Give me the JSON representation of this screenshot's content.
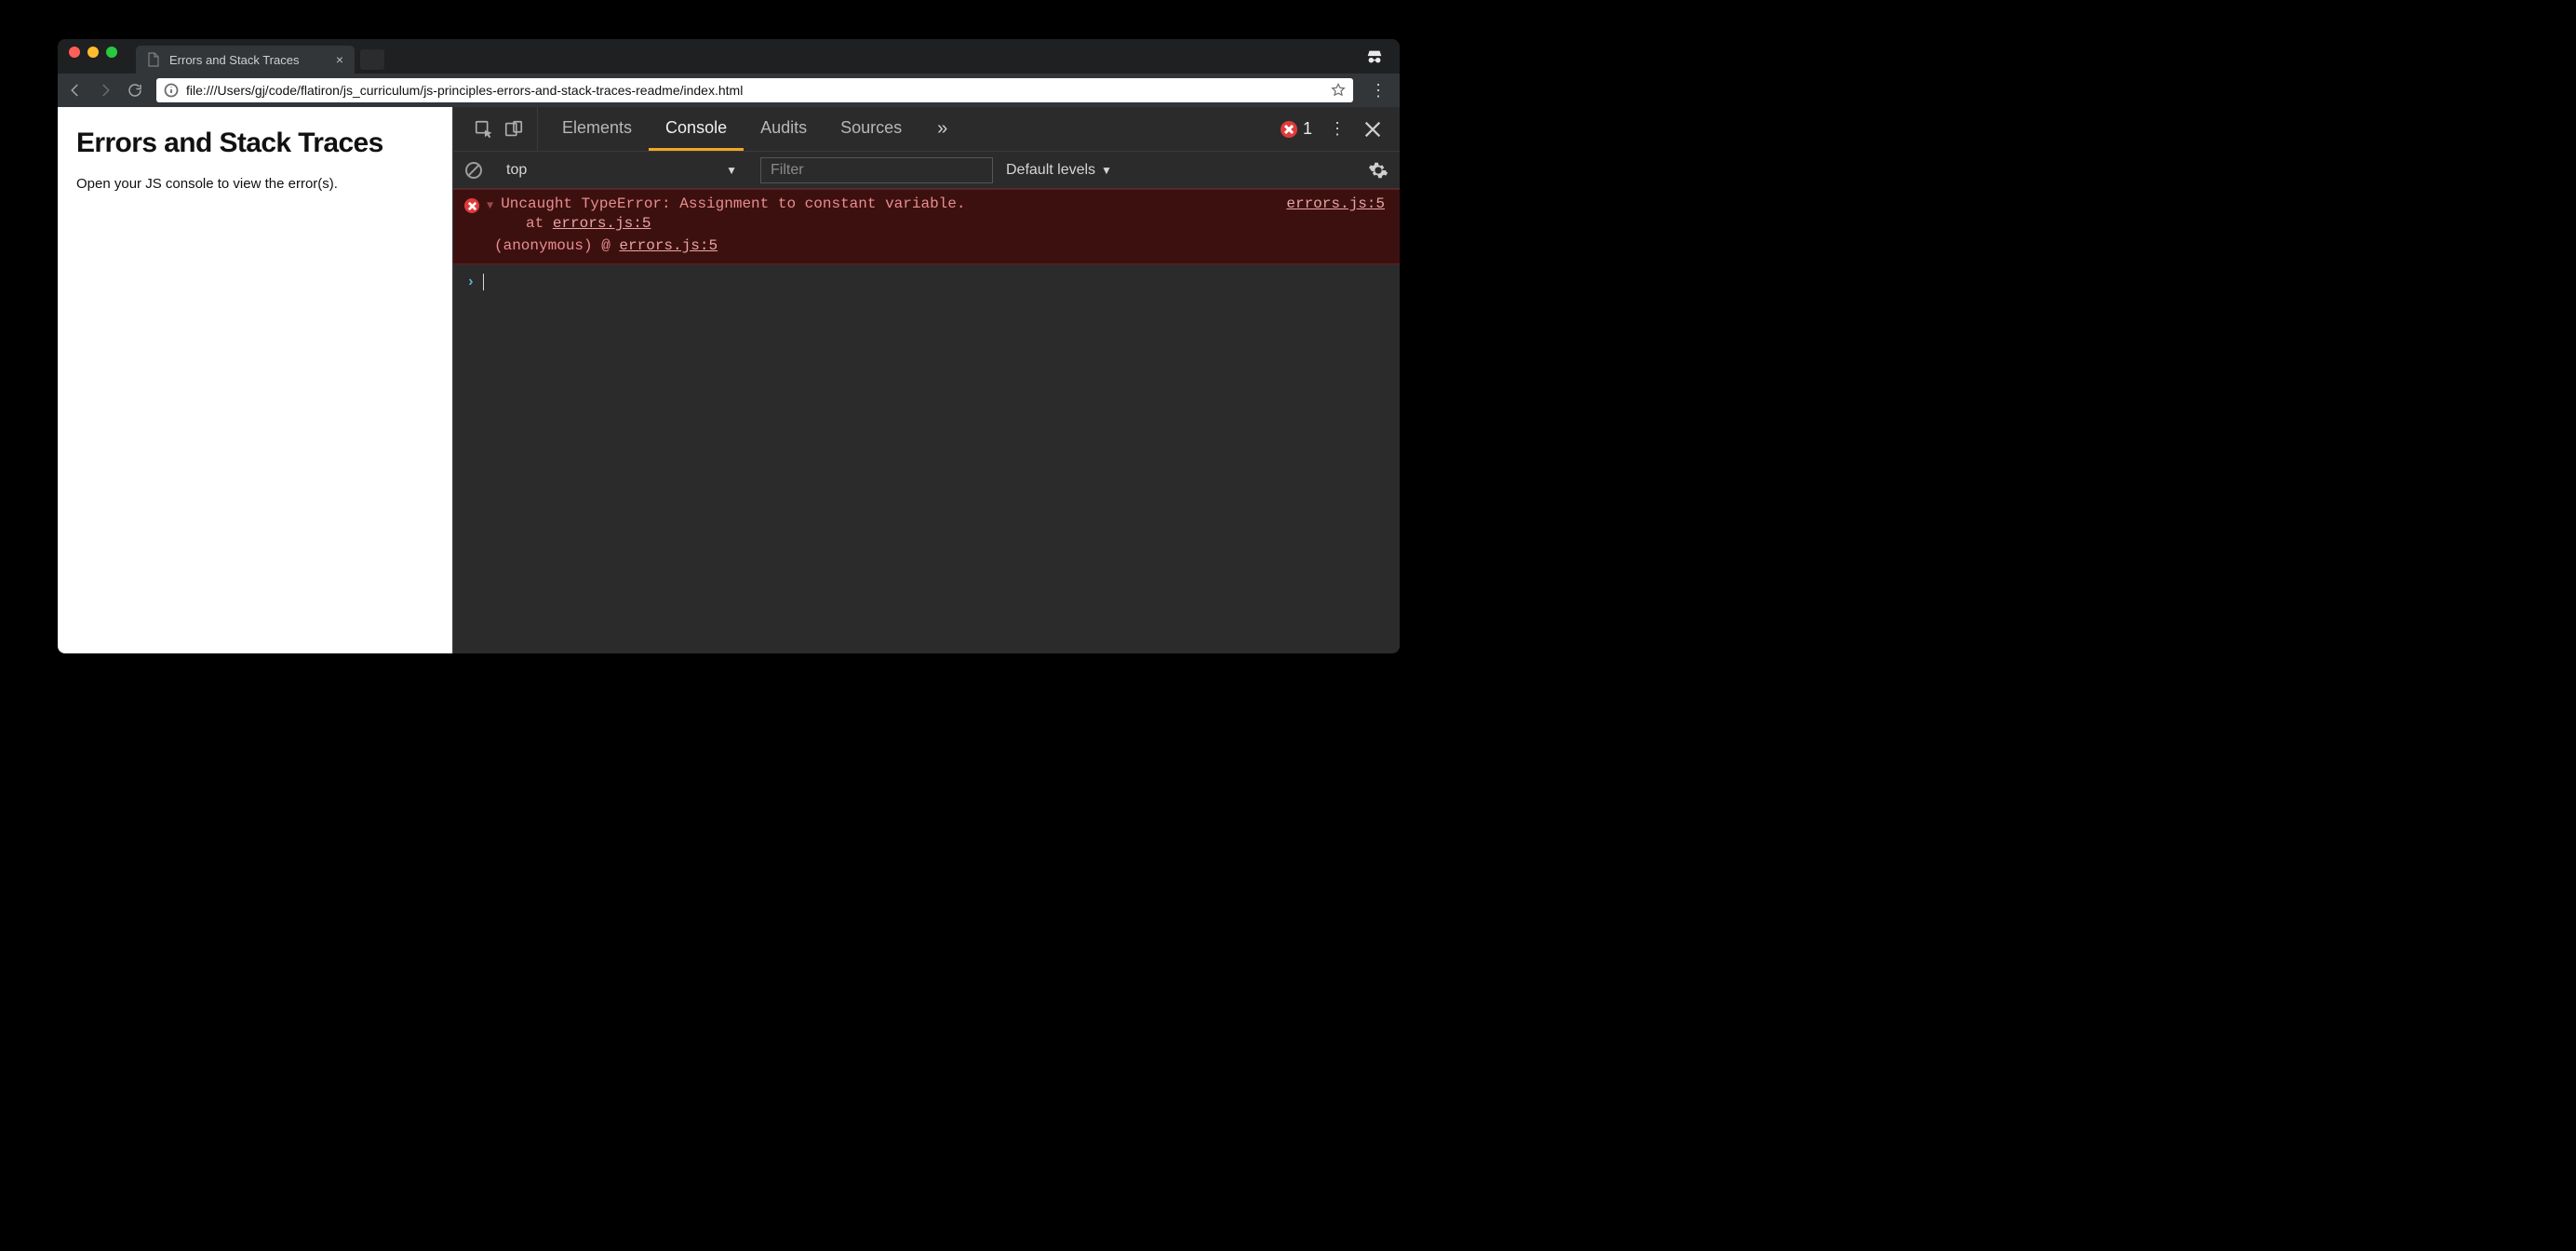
{
  "browser": {
    "tab_title": "Errors and Stack Traces",
    "url": "file:///Users/gj/code/flatiron/js_curriculum/js-principles-errors-and-stack-traces-readme/index.html"
  },
  "page": {
    "heading": "Errors and Stack Traces",
    "paragraph": "Open your JS console to view the error(s)."
  },
  "devtools": {
    "tabs": {
      "elements": "Elements",
      "console": "Console",
      "audits": "Audits",
      "sources": "Sources"
    },
    "error_count": "1",
    "filterbar": {
      "context": "top",
      "filter_placeholder": "Filter",
      "levels": "Default levels"
    },
    "console": {
      "message": "Uncaught TypeError: Assignment to constant variable.",
      "stack_at_prefix": "at ",
      "stack_at_link": "errors.js:5",
      "location": "errors.js:5",
      "anonymous_prefix": "(anonymous) @ ",
      "anonymous_link": "errors.js:5"
    }
  }
}
